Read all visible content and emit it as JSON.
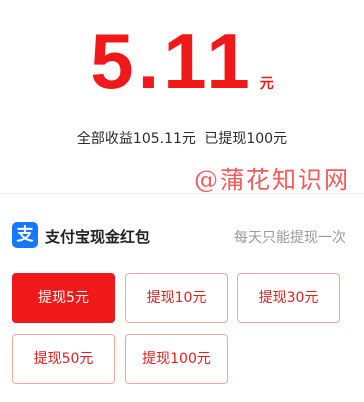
{
  "balance": {
    "amount": "5.11",
    "unit": "元"
  },
  "summary": {
    "total_label": "全部收益105.11元",
    "withdrawn_label": "已提现100元"
  },
  "watermark": "@蒲花知识网",
  "section": {
    "logo_glyph": "支",
    "title": "支付宝现金红包",
    "hint": "每天只能提现一次"
  },
  "options": [
    {
      "label": "提现5元",
      "selected": true
    },
    {
      "label": "提现10元",
      "selected": false
    },
    {
      "label": "提现30元",
      "selected": false
    },
    {
      "label": "提现50元",
      "selected": false
    },
    {
      "label": "提现100元",
      "selected": false
    }
  ],
  "colors": {
    "accent": "#f01818",
    "option_border": "#f5a3a3",
    "alipay_blue": "#1677ff",
    "hint_gray": "#9a9a9a"
  }
}
